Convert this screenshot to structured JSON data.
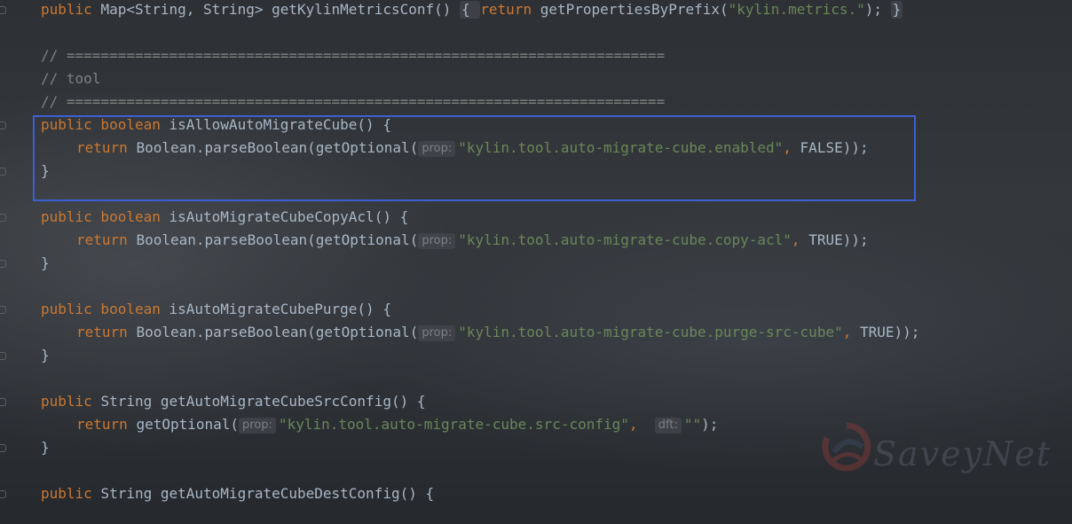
{
  "editor": {
    "lines": [
      {
        "id": "l1",
        "tokens": [
          {
            "t": "kw",
            "v": "public "
          },
          {
            "t": "txt",
            "v": "Map<String, String> getKylinMetricsConf() "
          },
          {
            "t": "fold",
            "v": "{ "
          },
          {
            "t": "kw",
            "v": "return "
          },
          {
            "t": "txt",
            "v": "getPropertiesByPrefix("
          },
          {
            "t": "str",
            "v": "\"kylin.metrics.\""
          },
          {
            "t": "txt",
            "v": "); "
          },
          {
            "t": "fold",
            "v": "}"
          }
        ]
      },
      {
        "id": "l2",
        "tokens": []
      },
      {
        "id": "l3",
        "tokens": [
          {
            "t": "cmt",
            "v": "// ======================================================================"
          }
        ]
      },
      {
        "id": "l4",
        "tokens": [
          {
            "t": "cmt",
            "v": "// tool"
          }
        ]
      },
      {
        "id": "l5",
        "tokens": [
          {
            "t": "cmt",
            "v": "// ======================================================================"
          }
        ]
      },
      {
        "id": "l6",
        "tokens": [
          {
            "t": "kw",
            "v": "public boolean "
          },
          {
            "t": "txt",
            "v": "isAllowAutoMigrateCube() {"
          }
        ]
      },
      {
        "id": "l7",
        "indent": true,
        "tokens": [
          {
            "t": "kw",
            "v": "return "
          },
          {
            "t": "txt",
            "v": "Boolean.parseBoolean(getOptional("
          },
          {
            "t": "hint",
            "v": "prop:"
          },
          {
            "t": "str",
            "v": "\"kylin.tool.auto-migrate-cube.enabled\""
          },
          {
            "t": "kw",
            "v": ", "
          },
          {
            "t": "txt",
            "v": "FALSE));"
          }
        ]
      },
      {
        "id": "l8",
        "tokens": [
          {
            "t": "txt",
            "v": "}"
          }
        ]
      },
      {
        "id": "l9",
        "tokens": []
      },
      {
        "id": "l10",
        "tokens": [
          {
            "t": "kw",
            "v": "public boolean "
          },
          {
            "t": "txt",
            "v": "isAutoMigrateCubeCopyAcl() {"
          }
        ]
      },
      {
        "id": "l11",
        "indent": true,
        "tokens": [
          {
            "t": "kw",
            "v": "return "
          },
          {
            "t": "txt",
            "v": "Boolean.parseBoolean(getOptional("
          },
          {
            "t": "hint",
            "v": "prop:"
          },
          {
            "t": "str",
            "v": "\"kylin.tool.auto-migrate-cube.copy-acl\""
          },
          {
            "t": "kw",
            "v": ", "
          },
          {
            "t": "txt",
            "v": "TRUE));"
          }
        ]
      },
      {
        "id": "l12",
        "tokens": [
          {
            "t": "txt",
            "v": "}"
          }
        ]
      },
      {
        "id": "l13",
        "tokens": []
      },
      {
        "id": "l14",
        "tokens": [
          {
            "t": "kw",
            "v": "public boolean "
          },
          {
            "t": "txt",
            "v": "isAutoMigrateCubePurge() {"
          }
        ]
      },
      {
        "id": "l15",
        "indent": true,
        "tokens": [
          {
            "t": "kw",
            "v": "return "
          },
          {
            "t": "txt",
            "v": "Boolean.parseBoolean(getOptional("
          },
          {
            "t": "hint",
            "v": "prop:"
          },
          {
            "t": "str",
            "v": "\"kylin.tool.auto-migrate-cube.purge-src-cube\""
          },
          {
            "t": "kw",
            "v": ", "
          },
          {
            "t": "txt",
            "v": "TRUE));"
          }
        ]
      },
      {
        "id": "l16",
        "tokens": [
          {
            "t": "txt",
            "v": "}"
          }
        ]
      },
      {
        "id": "l17",
        "tokens": []
      },
      {
        "id": "l18",
        "tokens": [
          {
            "t": "kw",
            "v": "public "
          },
          {
            "t": "txt",
            "v": "String getAutoMigrateCubeSrcConfig() {"
          }
        ]
      },
      {
        "id": "l19",
        "indent": true,
        "tokens": [
          {
            "t": "kw",
            "v": "return "
          },
          {
            "t": "txt",
            "v": "getOptional("
          },
          {
            "t": "hint",
            "v": "prop:"
          },
          {
            "t": "str",
            "v": "\"kylin.tool.auto-migrate-cube.src-config\""
          },
          {
            "t": "kw",
            "v": ",  "
          },
          {
            "t": "hint",
            "v": "dft:"
          },
          {
            "t": "str",
            "v": "\"\""
          },
          {
            "t": "txt",
            "v": ");"
          }
        ]
      },
      {
        "id": "l20",
        "tokens": [
          {
            "t": "txt",
            "v": "}"
          }
        ]
      },
      {
        "id": "l21",
        "tokens": []
      },
      {
        "id": "l22",
        "tokens": [
          {
            "t": "kw",
            "v": "public "
          },
          {
            "t": "txt",
            "v": "String getAutoMigrateCubeDestConfig() {"
          }
        ]
      }
    ]
  },
  "highlight": {
    "color": "#3c5fd2"
  },
  "watermark": {
    "text": "SaveyNet",
    "icon": "swirl-logo-icon"
  },
  "colors": {
    "keyword": "#cc7832",
    "string": "#6a8759",
    "comment": "#808080",
    "text": "#a9b7c6"
  }
}
